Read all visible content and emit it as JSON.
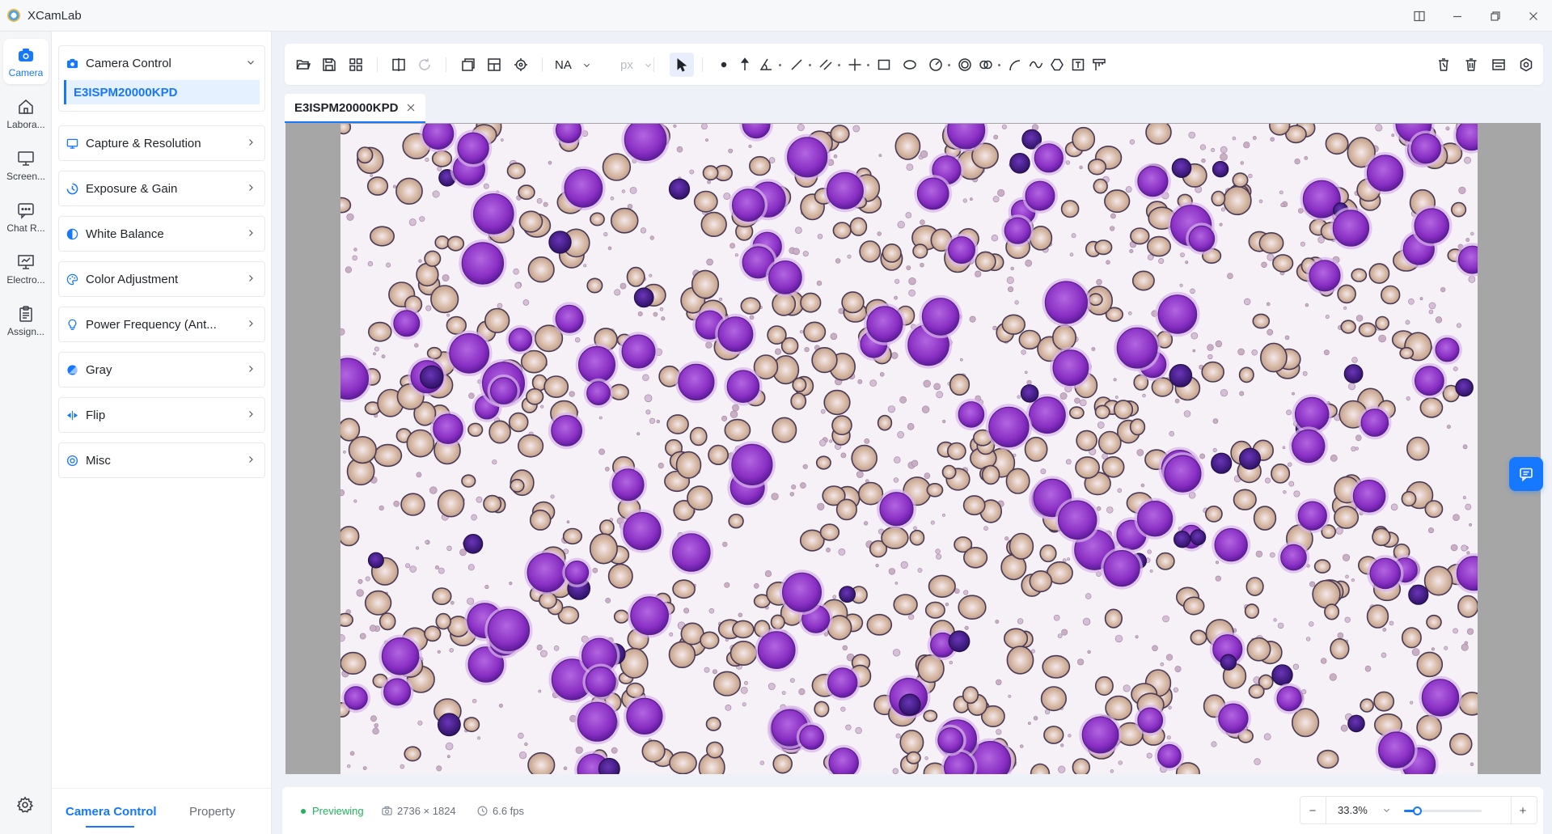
{
  "app": {
    "title": "XCamLab"
  },
  "nav": {
    "items": [
      {
        "label": "Camera",
        "icon": "camera-icon"
      },
      {
        "label": "Labora...",
        "icon": "home-icon"
      },
      {
        "label": "Screen...",
        "icon": "monitor-icon"
      },
      {
        "label": "Chat R...",
        "icon": "chat-icon"
      },
      {
        "label": "Electro...",
        "icon": "presentation-icon"
      },
      {
        "label": "Assign...",
        "icon": "clipboard-icon"
      }
    ],
    "settings_icon": "gear-icon"
  },
  "panel": {
    "camera_control": {
      "title": "Camera Control",
      "device": "E3ISPM20000KPD"
    },
    "groups": [
      {
        "title": "Capture & Resolution",
        "icon": "capture-icon"
      },
      {
        "title": "Exposure & Gain",
        "icon": "exposure-icon"
      },
      {
        "title": "White Balance",
        "icon": "white-balance-icon"
      },
      {
        "title": "Color Adjustment",
        "icon": "palette-icon"
      },
      {
        "title": "Power Frequency (Ant...",
        "icon": "bulb-icon"
      },
      {
        "title": "Gray",
        "icon": "gray-icon"
      },
      {
        "title": "Flip",
        "icon": "flip-icon"
      },
      {
        "title": "Misc",
        "icon": "misc-icon"
      }
    ],
    "tabs": {
      "camera_control": "Camera Control",
      "property": "Property"
    }
  },
  "toolbar": {
    "magnification": "NA",
    "unit": "px"
  },
  "image_tab": {
    "label": "E3ISPM20000KPD"
  },
  "status": {
    "state": "Previewing",
    "resolution": "2736 × 1824",
    "fps": "6.6 fps",
    "zoom": "33.3%",
    "zoom_fraction": 0.17
  },
  "colors": {
    "accent": "#1677ff",
    "status_ok": "#21b35b",
    "cell_nucleus": "#8a2fc4",
    "cell_dark": "#4a1c8c",
    "rbc_fill": "#d9b9a8",
    "rbc_outline": "#4b3a55"
  }
}
